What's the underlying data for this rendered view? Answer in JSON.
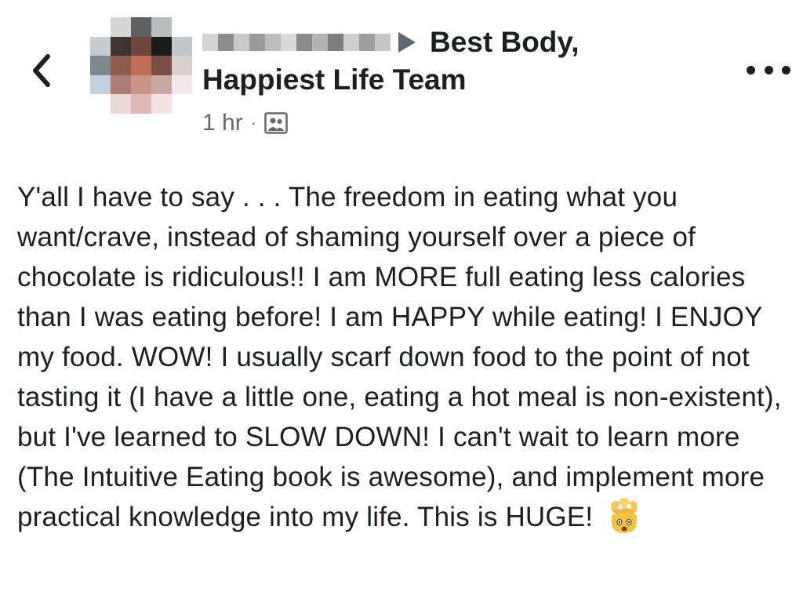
{
  "header": {
    "group_name_line1": "Best Body,",
    "group_name_line2": "Happiest Life Team",
    "timestamp": "1 hr",
    "separator": "·",
    "audience_icon": "group-audience-icon"
  },
  "post": {
    "text": "Y'all I have to say . . . The freedom in eating what you want/crave, instead of shaming yourself over a piece of chocolate is ridiculous!! I am MORE full eating less calories than I was eating before! I am HAPPY while eating! I ENJOY my food. WOW! I usually scarf down food to the point of not tasting it (I have a little one, eating a hot meal is non-existent), but I've learned to SLOW DOWN! I can't wait to learn more (The Intuitive Eating book is awesome), and implement more practical knowledge into my life. This is HUGE!",
    "emoji": "exploding-head-emoji"
  },
  "icons": {
    "back": "chevron-left-icon",
    "more": "more-options-icon"
  },
  "colors": {
    "text": "#1c1e21",
    "secondary_text": "#65676b"
  }
}
